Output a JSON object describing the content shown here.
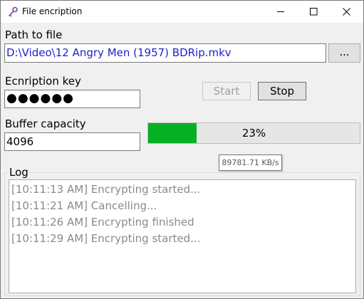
{
  "window": {
    "title": "File encription",
    "icon": "key-icon",
    "controls": {
      "minimize": "minimize-icon",
      "maximize": "maximize-icon",
      "close": "close-icon"
    }
  },
  "path": {
    "label": "Path to file",
    "value": "D:\\Video\\12 Angry Men (1957) BDRip.mkv",
    "browse_label": "..."
  },
  "key": {
    "label": "Ecnription key",
    "value": "●●●●●●"
  },
  "buffer": {
    "label": "Buffer capacity",
    "value": "4096"
  },
  "actions": {
    "start_label": "Start",
    "start_enabled": false,
    "stop_label": "Stop"
  },
  "progress": {
    "percent": 23,
    "text": "23%",
    "fill_color": "#06b025",
    "speed": "89781.71 KB/s"
  },
  "log": {
    "label": "Log",
    "lines": [
      "[10:11:13 AM] Encrypting started...",
      "[10:11:21 AM] Cancelling...",
      "[10:11:26 AM] Encrypting finished",
      "[10:11:29 AM] Encrypting started..."
    ]
  }
}
